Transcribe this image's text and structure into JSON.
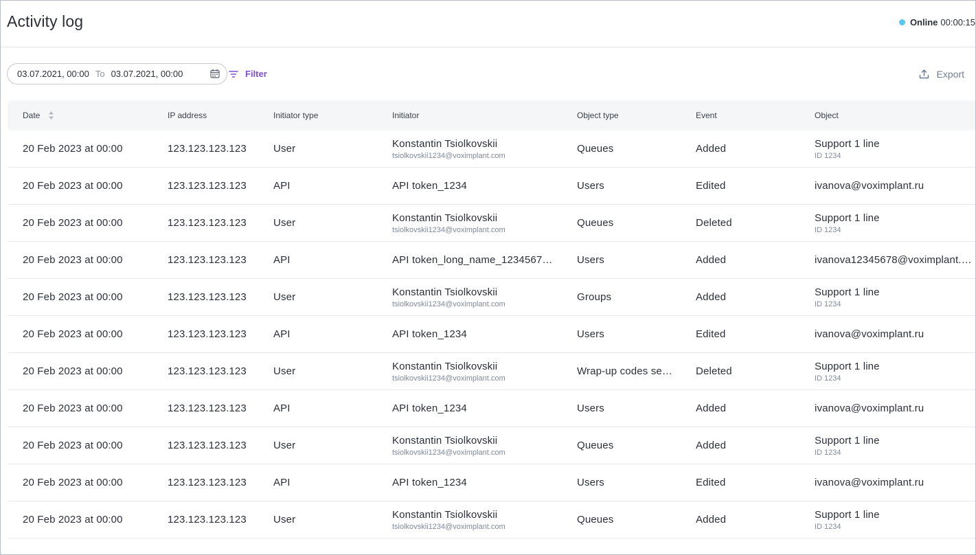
{
  "header": {
    "title": "Activity log",
    "status_label": "Online",
    "status_timer": "00:00:15",
    "status_color": "#5ac8ee"
  },
  "toolbar": {
    "date_from": "03.07.2021, 00:00",
    "date_separator": "To",
    "date_to": "03.07.2021, 00:00",
    "filter_label": "Filter",
    "export_label": "Export",
    "accent_color": "#7b4fd6"
  },
  "table": {
    "columns": [
      "Date",
      "IP address",
      "Initiator type",
      "Initiator",
      "Object type",
      "Event",
      "Object"
    ],
    "rows": [
      {
        "date": "20 Feb 2023 at 00:00",
        "ip": "123.123.123.123",
        "initiator_type": "User",
        "initiator": "Konstantin Tsiolkovskii",
        "initiator_sub": "tsiolkovskii1234@voximplant.com",
        "object_type": "Queues",
        "event": "Added",
        "object": "Support 1 line",
        "object_sub": "ID 1234"
      },
      {
        "date": "20 Feb 2023 at 00:00",
        "ip": "123.123.123.123",
        "initiator_type": "API",
        "initiator": "API token_1234",
        "initiator_sub": "",
        "object_type": "Users",
        "event": "Edited",
        "object": "ivanova@voximplant.ru",
        "object_sub": ""
      },
      {
        "date": "20 Feb 2023 at 00:00",
        "ip": "123.123.123.123",
        "initiator_type": "User",
        "initiator": "Konstantin Tsiolkovskii",
        "initiator_sub": "tsiolkovskii1234@voximplant.com",
        "object_type": "Queues",
        "event": "Deleted",
        "object": "Support 1 line",
        "object_sub": "ID 1234"
      },
      {
        "date": "20 Feb 2023 at 00:00",
        "ip": "123.123.123.123",
        "initiator_type": "API",
        "initiator": "API token_long_name_1234567…",
        "initiator_sub": "",
        "object_type": "Users",
        "event": "Added",
        "object": "ivanova12345678@voximplant.…",
        "object_sub": ""
      },
      {
        "date": "20 Feb 2023 at 00:00",
        "ip": "123.123.123.123",
        "initiator_type": "User",
        "initiator": "Konstantin Tsiolkovskii",
        "initiator_sub": "tsiolkovskii1234@voximplant.com",
        "object_type": "Groups",
        "event": "Added",
        "object": "Support 1 line",
        "object_sub": "ID 1234"
      },
      {
        "date": "20 Feb 2023 at 00:00",
        "ip": "123.123.123.123",
        "initiator_type": "API",
        "initiator": "API token_1234",
        "initiator_sub": "",
        "object_type": "Users",
        "event": "Edited",
        "object": "ivanova@voximplant.ru",
        "object_sub": ""
      },
      {
        "date": "20 Feb 2023 at 00:00",
        "ip": "123.123.123.123",
        "initiator_type": "User",
        "initiator": "Konstantin Tsiolkovskii",
        "initiator_sub": "tsiolkovskii1234@voximplant.com",
        "object_type": "Wrap-up codes se…",
        "event": "Deleted",
        "object": "Support 1 line",
        "object_sub": "ID 1234"
      },
      {
        "date": "20 Feb 2023 at 00:00",
        "ip": "123.123.123.123",
        "initiator_type": "API",
        "initiator": "API token_1234",
        "initiator_sub": "",
        "object_type": "Users",
        "event": "Added",
        "object": "ivanova@voximplant.ru",
        "object_sub": ""
      },
      {
        "date": "20 Feb 2023 at 00:00",
        "ip": "123.123.123.123",
        "initiator_type": "User",
        "initiator": "Konstantin Tsiolkovskii",
        "initiator_sub": "tsiolkovskii1234@voximplant.com",
        "object_type": "Queues",
        "event": "Added",
        "object": "Support 1 line",
        "object_sub": "ID 1234"
      },
      {
        "date": "20 Feb 2023 at 00:00",
        "ip": "123.123.123.123",
        "initiator_type": "API",
        "initiator": "API token_1234",
        "initiator_sub": "",
        "object_type": "Users",
        "event": "Edited",
        "object": "ivanova@voximplant.ru",
        "object_sub": ""
      },
      {
        "date": "20 Feb 2023 at 00:00",
        "ip": "123.123.123.123",
        "initiator_type": "User",
        "initiator": "Konstantin Tsiolkovskii",
        "initiator_sub": "tsiolkovskii1234@voximplant.com",
        "object_type": "Queues",
        "event": "Added",
        "object": "Support 1 line",
        "object_sub": "ID 1234"
      }
    ]
  }
}
